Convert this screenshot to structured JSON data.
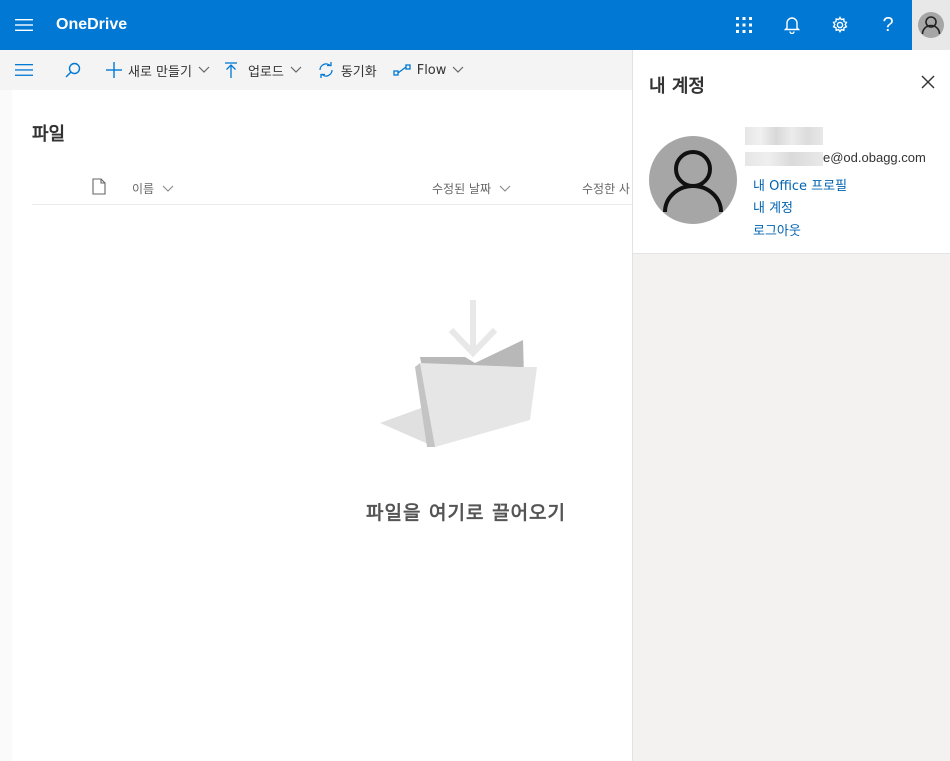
{
  "app": {
    "brand": "OneDrive"
  },
  "colors": {
    "suite_bar": "#0078d4",
    "link": "#0063b1",
    "panel_bg": "#f4f2f0"
  },
  "icons": {
    "topbar_right": [
      "app-launcher-icon",
      "bell-icon",
      "gear-icon",
      "help-icon",
      "avatar-icon"
    ]
  },
  "help_glyph": "?",
  "commandbar": {
    "new_label": "새로 만들기",
    "upload_label": "업로드",
    "sync_label": "동기화",
    "flow_label": "Flow"
  },
  "main": {
    "title": "파일",
    "columns": {
      "name": "이름",
      "modified": "수정된 날짜",
      "modified_by": "수정한 사"
    },
    "empty_text": "파일을 여기로 끌어오기"
  },
  "account_panel": {
    "title": "내 계정",
    "email_suffix": "e@od.obagg.com",
    "links": [
      "내 Office 프로필",
      "내 계정",
      "로그아웃"
    ]
  }
}
